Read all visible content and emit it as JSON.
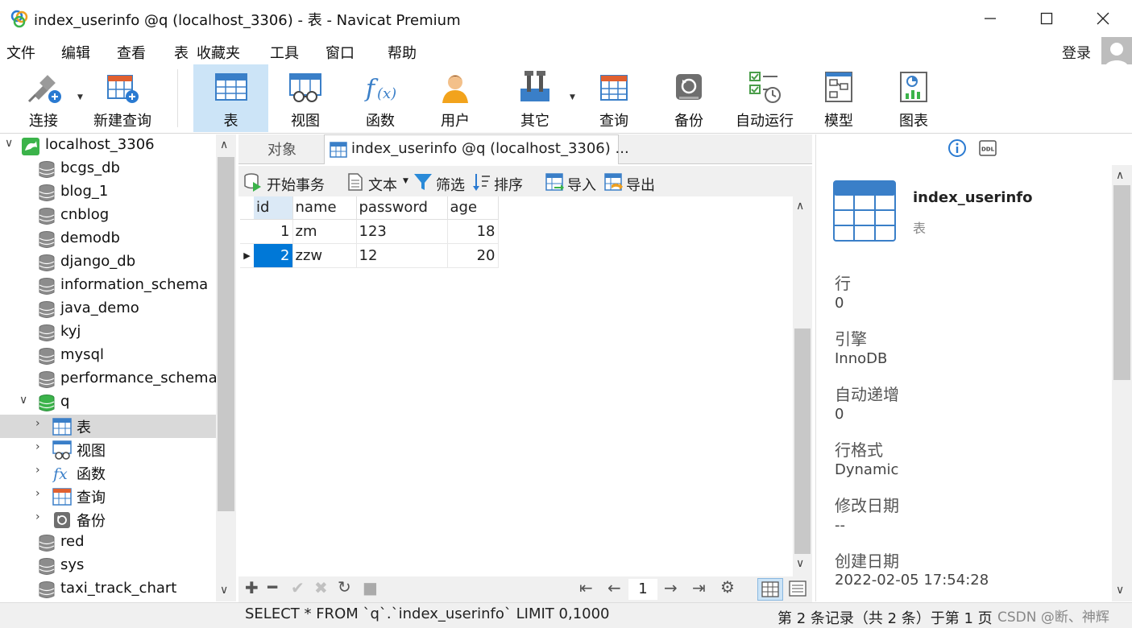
{
  "window": {
    "title": "index_userinfo @q (localhost_3306) - 表 - Navicat Premium"
  },
  "menu": {
    "items": [
      "文件",
      "编辑",
      "查看",
      "表",
      "收藏夹",
      "工具",
      "窗口",
      "帮助"
    ],
    "login": "登录"
  },
  "toolbar": {
    "items": [
      {
        "label": "连接",
        "icon": "connect-plug-icon"
      },
      {
        "label": "新建查询",
        "icon": "new-query-icon"
      },
      {
        "label": "表",
        "icon": "table-icon",
        "active": true
      },
      {
        "label": "视图",
        "icon": "view-icon"
      },
      {
        "label": "函数",
        "icon": "function-icon"
      },
      {
        "label": "用户",
        "icon": "user-icon"
      },
      {
        "label": "其它",
        "icon": "tools-icon"
      },
      {
        "label": "查询",
        "icon": "query-icon"
      },
      {
        "label": "备份",
        "icon": "backup-icon"
      },
      {
        "label": "自动运行",
        "icon": "schedule-icon"
      },
      {
        "label": "模型",
        "icon": "model-icon"
      },
      {
        "label": "图表",
        "icon": "chart-icon"
      }
    ]
  },
  "sidebar": {
    "connection": "localhost_3306",
    "databases": [
      "bcgs_db",
      "blog_1",
      "cnblog",
      "demodb",
      "django_db",
      "information_schema",
      "java_demo",
      "kyj",
      "mysql",
      "performance_schema",
      "q"
    ],
    "q_children": [
      "表",
      "视图",
      "函数",
      "查询",
      "备份"
    ],
    "databases_after": [
      "red",
      "sys",
      "taxi_track_chart"
    ]
  },
  "tabs": {
    "objects": "对象",
    "active": "index_userinfo @q (localhost_3306) ..."
  },
  "subtoolbar": {
    "begin_tx": "开始事务",
    "text": "文本",
    "filter": "筛选",
    "sort": "排序",
    "import": "导入",
    "export": "导出"
  },
  "grid": {
    "columns": [
      "id",
      "name",
      "password",
      "age"
    ],
    "rows": [
      [
        "1",
        "zm",
        "123",
        "18"
      ],
      [
        "2",
        "zzw",
        "12",
        "20"
      ]
    ],
    "selected_row": 1
  },
  "pager": {
    "page": "1"
  },
  "status": {
    "sql": "SELECT * FROM `q`.`index_userinfo` LIMIT 0,1000",
    "records": "第 2 条记录（共 2 条）于第 1 页",
    "watermark": "CSDN @断、神辉"
  },
  "info": {
    "table_name": "index_userinfo",
    "object_type": "表",
    "fields": [
      {
        "label": "行",
        "value": "0"
      },
      {
        "label": "引擎",
        "value": "InnoDB"
      },
      {
        "label": "自动递增",
        "value": "0"
      },
      {
        "label": "行格式",
        "value": "Dynamic"
      },
      {
        "label": "修改日期",
        "value": "--"
      },
      {
        "label": "创建日期",
        "value": "2022-02-05 17:54:28"
      }
    ]
  },
  "colors": {
    "accent": "#0078d7",
    "toolbar_active": "#cce4f7",
    "table_icon_blue": "#3a7fc8"
  }
}
